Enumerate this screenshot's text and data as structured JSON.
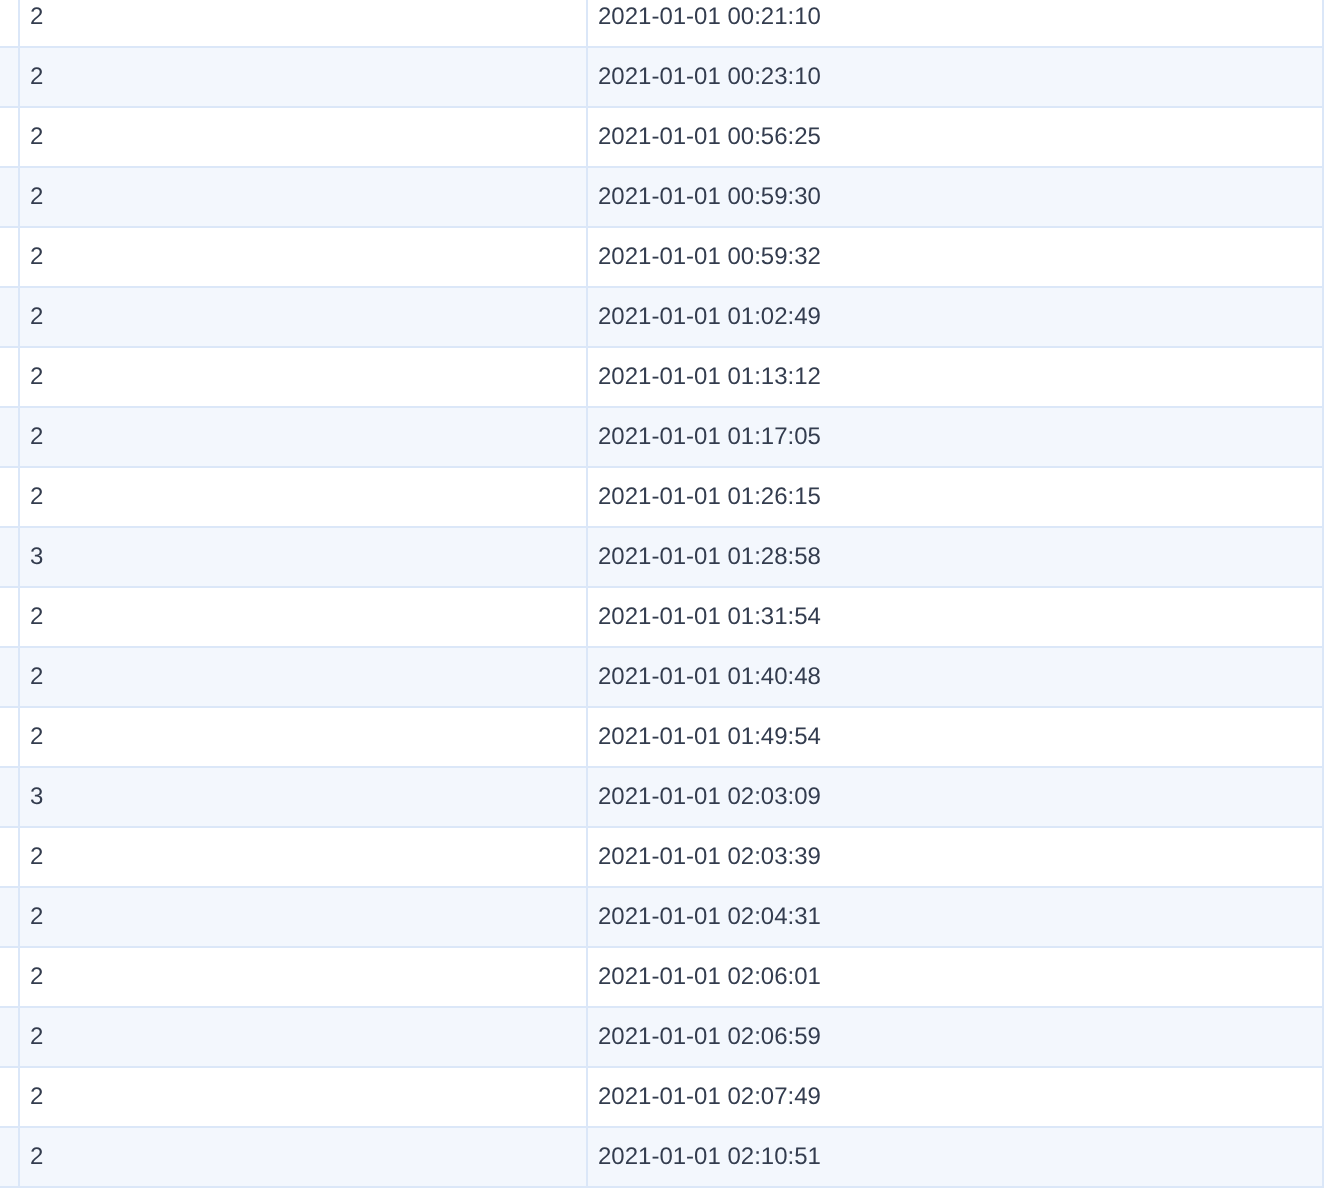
{
  "table": {
    "rows": [
      {
        "column_2": "2",
        "column_3": "2021-01-01 00:21:10"
      },
      {
        "column_2": "2",
        "column_3": "2021-01-01 00:23:10"
      },
      {
        "column_2": "2",
        "column_3": "2021-01-01 00:56:25"
      },
      {
        "column_2": "2",
        "column_3": "2021-01-01 00:59:30"
      },
      {
        "column_2": "2",
        "column_3": "2021-01-01 00:59:32"
      },
      {
        "column_2": "2",
        "column_3": "2021-01-01 01:02:49"
      },
      {
        "column_2": "2",
        "column_3": "2021-01-01 01:13:12"
      },
      {
        "column_2": "2",
        "column_3": "2021-01-01 01:17:05"
      },
      {
        "column_2": "2",
        "column_3": "2021-01-01 01:26:15"
      },
      {
        "column_2": "3",
        "column_3": "2021-01-01 01:28:58"
      },
      {
        "column_2": "2",
        "column_3": "2021-01-01 01:31:54"
      },
      {
        "column_2": "2",
        "column_3": "2021-01-01 01:40:48"
      },
      {
        "column_2": "2",
        "column_3": "2021-01-01 01:49:54"
      },
      {
        "column_2": "3",
        "column_3": "2021-01-01 02:03:09"
      },
      {
        "column_2": "2",
        "column_3": "2021-01-01 02:03:39"
      },
      {
        "column_2": "2",
        "column_3": "2021-01-01 02:04:31"
      },
      {
        "column_2": "2",
        "column_3": "2021-01-01 02:06:01"
      },
      {
        "column_2": "2",
        "column_3": "2021-01-01 02:06:59"
      },
      {
        "column_2": "2",
        "column_3": "2021-01-01 02:07:49"
      },
      {
        "column_2": "2",
        "column_3": "2021-01-01 02:10:51"
      }
    ]
  }
}
